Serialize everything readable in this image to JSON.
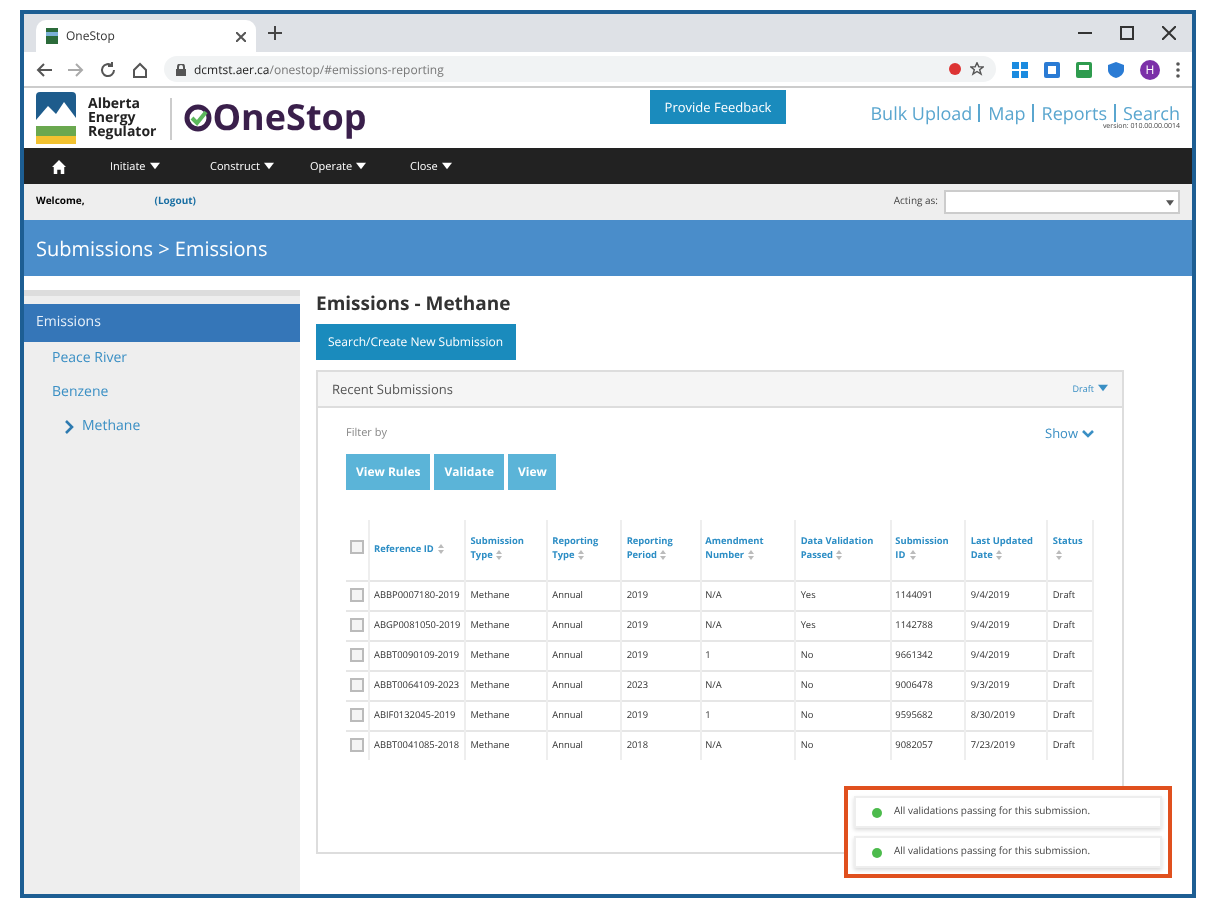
{
  "browser": {
    "tab_title": "OneStop",
    "url_host": "dcmtst.aer.ca",
    "url_path": "/onestop/#emissions-reporting",
    "profile_initial": "H"
  },
  "header": {
    "org_lines": [
      "Alberta",
      "Energy",
      "Regulator"
    ],
    "product": "OneStop",
    "feedback_button": "Provide Feedback",
    "links": [
      "Bulk Upload",
      "Map",
      "Reports",
      "Search"
    ],
    "version": "version: 010.00.00.0014"
  },
  "nav": [
    "Initiate",
    "Construct",
    "Operate",
    "Close"
  ],
  "welcome": {
    "label": "Welcome,",
    "logout": "(Logout)",
    "acting_as": "Acting as:"
  },
  "breadcrumb": "Submissions > Emissions",
  "sidebar": [
    {
      "label": "Emissions",
      "selected": true,
      "children": [
        {
          "label": "Peace River",
          "selected": false
        },
        {
          "label": "Benzene",
          "selected": false
        },
        {
          "label": "Methane",
          "selected": false,
          "current": true
        }
      ]
    }
  ],
  "page_title": "Emissions - Methane",
  "new_button": "Search/Create New Submission",
  "panel": {
    "title": "Recent Submissions",
    "status_filter": "Draft",
    "filter_label": "Filter by",
    "show_link": "Show",
    "buttons": [
      "View Rules",
      "Validate",
      "View"
    ]
  },
  "table": {
    "select_all_checked": false,
    "columns": [
      "Reference ID",
      "Submission Type",
      "Reporting Type",
      "Reporting Period",
      "Amendment Number",
      "Data Validation Passed",
      "Submission ID",
      "Last Updated Date",
      "Status"
    ],
    "rows": [
      {
        "checked": false,
        "cells": [
          "ABBP0007180-2019",
          "Methane",
          "Annual",
          "2019",
          "N/A",
          "Yes",
          "1144091",
          "9/4/2019",
          "Draft"
        ]
      },
      {
        "checked": false,
        "cells": [
          "ABGP0081050-2019",
          "Methane",
          "Annual",
          "2019",
          "N/A",
          "Yes",
          "1142788",
          "9/4/2019",
          "Draft"
        ]
      },
      {
        "checked": false,
        "cells": [
          "ABBT0090109-2019",
          "Methane",
          "Annual",
          "2019",
          "1",
          "No",
          "9661342",
          "9/4/2019",
          "Draft"
        ]
      },
      {
        "checked": false,
        "cells": [
          "ABBT0064109-2023",
          "Methane",
          "Annual",
          "2023",
          "N/A",
          "No",
          "9006478",
          "9/3/2019",
          "Draft"
        ]
      },
      {
        "checked": false,
        "cells": [
          "ABIF0132045-2019",
          "Methane",
          "Annual",
          "2019",
          "1",
          "No",
          "9595682",
          "8/30/2019",
          "Draft"
        ]
      },
      {
        "checked": false,
        "cells": [
          "ABBT0041085-2018",
          "Methane",
          "Annual",
          "2018",
          "N/A",
          "No",
          "9082057",
          "7/23/2019",
          "Draft"
        ]
      }
    ]
  },
  "toasts": [
    {
      "message": "All validations passing for this submission.",
      "color": "#4cbb4c"
    },
    {
      "message": "All validations passing for this submission.",
      "color": "#4cbb4c"
    }
  ]
}
